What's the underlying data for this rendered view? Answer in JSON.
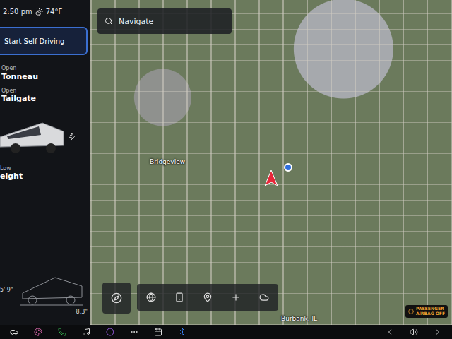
{
  "status_bar": {
    "time": "2:50 pm",
    "temperature": "74°F"
  },
  "self_driving_button": {
    "label": "Start Self-Driving"
  },
  "vehicle_status": [
    {
      "state": "Open",
      "label": "Tonneau"
    },
    {
      "state": "Open",
      "label": "Tailgate"
    }
  ],
  "suspension": {
    "state": "Low",
    "label": "eight"
  },
  "dimensions": {
    "height": "5' 9\"",
    "clearance": "8.3\""
  },
  "search": {
    "placeholder": "Navigate"
  },
  "map_labels": [
    {
      "text": "Bridgeview"
    },
    {
      "text": "Burbank, IL"
    }
  ],
  "airbag_badge": {
    "line1": "PASSENGER",
    "line2": "AIRBAG OFF"
  }
}
